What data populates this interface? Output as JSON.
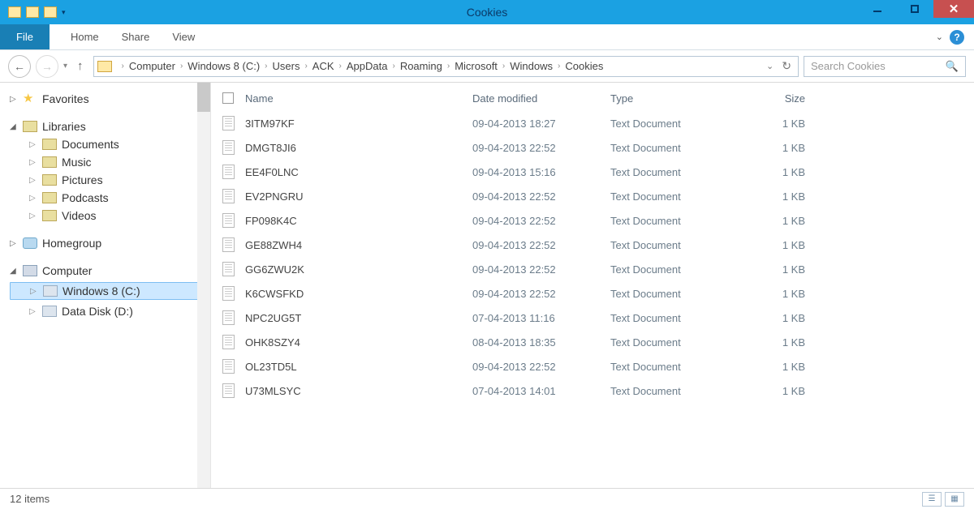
{
  "window_title": "Cookies",
  "ribbon": {
    "file": "File",
    "tabs": [
      "Home",
      "Share",
      "View"
    ]
  },
  "breadcrumbs": [
    "Computer",
    "Windows 8 (C:)",
    "Users",
    "ACK",
    "AppData",
    "Roaming",
    "Microsoft",
    "Windows",
    "Cookies"
  ],
  "search_placeholder": "Search Cookies",
  "tree": {
    "favorites": "Favorites",
    "libraries": "Libraries",
    "lib_items": [
      "Documents",
      "Music",
      "Pictures",
      "Podcasts",
      "Videos"
    ],
    "homegroup": "Homegroup",
    "computer": "Computer",
    "drives": [
      "Windows 8 (C:)",
      "Data Disk (D:)"
    ]
  },
  "columns": {
    "name": "Name",
    "date": "Date modified",
    "type": "Type",
    "size": "Size"
  },
  "files": [
    {
      "name": "3ITM97KF",
      "date": "09-04-2013 18:27",
      "type": "Text Document",
      "size": "1 KB"
    },
    {
      "name": "DMGT8JI6",
      "date": "09-04-2013 22:52",
      "type": "Text Document",
      "size": "1 KB"
    },
    {
      "name": "EE4F0LNC",
      "date": "09-04-2013 15:16",
      "type": "Text Document",
      "size": "1 KB"
    },
    {
      "name": "EV2PNGRU",
      "date": "09-04-2013 22:52",
      "type": "Text Document",
      "size": "1 KB"
    },
    {
      "name": "FP098K4C",
      "date": "09-04-2013 22:52",
      "type": "Text Document",
      "size": "1 KB"
    },
    {
      "name": "GE88ZWH4",
      "date": "09-04-2013 22:52",
      "type": "Text Document",
      "size": "1 KB"
    },
    {
      "name": "GG6ZWU2K",
      "date": "09-04-2013 22:52",
      "type": "Text Document",
      "size": "1 KB"
    },
    {
      "name": "K6CWSFKD",
      "date": "09-04-2013 22:52",
      "type": "Text Document",
      "size": "1 KB"
    },
    {
      "name": "NPC2UG5T",
      "date": "07-04-2013 11:16",
      "type": "Text Document",
      "size": "1 KB"
    },
    {
      "name": "OHK8SZY4",
      "date": "08-04-2013 18:35",
      "type": "Text Document",
      "size": "1 KB"
    },
    {
      "name": "OL23TD5L",
      "date": "09-04-2013 22:52",
      "type": "Text Document",
      "size": "1 KB"
    },
    {
      "name": "U73MLSYC",
      "date": "07-04-2013 14:01",
      "type": "Text Document",
      "size": "1 KB"
    }
  ],
  "status": "12 items"
}
